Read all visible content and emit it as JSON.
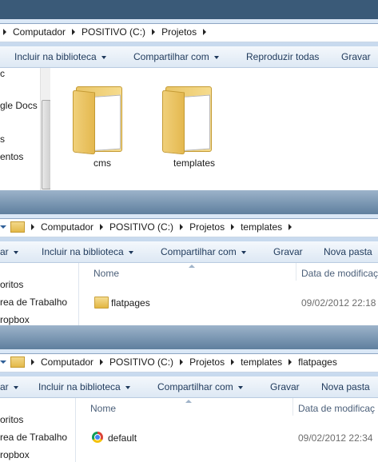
{
  "window1": {
    "breadcrumbs": [
      "Computador",
      "POSITIVO (C:)",
      "Projetos"
    ],
    "toolbar": [
      "Incluir na biblioteca",
      "Compartilhar com",
      "Reproduzir todas",
      "Gravar"
    ],
    "nav": [
      "gle Docs",
      "s",
      "entos"
    ],
    "items": [
      {
        "name": "cms"
      },
      {
        "name": "templates"
      }
    ]
  },
  "window2": {
    "breadcrumbs": [
      "Computador",
      "POSITIVO (C:)",
      "Projetos",
      "templates"
    ],
    "toolbar": [
      "ar",
      "Incluir na biblioteca",
      "Compartilhar com",
      "Gravar",
      "Nova pasta"
    ],
    "nav": [
      "oritos",
      "rea de Trabalho",
      "ropbox"
    ],
    "columns": {
      "name": "Nome",
      "date": "Data de modificaç"
    },
    "rows": [
      {
        "name": "flatpages",
        "date": "09/02/2012 22:18",
        "icon": "folder-icon"
      }
    ]
  },
  "window3": {
    "breadcrumbs": [
      "Computador",
      "POSITIVO (C:)",
      "Projetos",
      "templates",
      "flatpages"
    ],
    "toolbar": [
      "ar",
      "Incluir na biblioteca",
      "Compartilhar com",
      "Gravar",
      "Nova pasta"
    ],
    "nav": [
      "oritos",
      "rea de Trabalho",
      "ropbox"
    ],
    "columns": {
      "name": "Nome",
      "date": "Data de modificaç"
    },
    "rows": [
      {
        "name": "default",
        "date": "09/02/2012 22:34",
        "icon": "chrome-html-file-icon"
      }
    ]
  }
}
